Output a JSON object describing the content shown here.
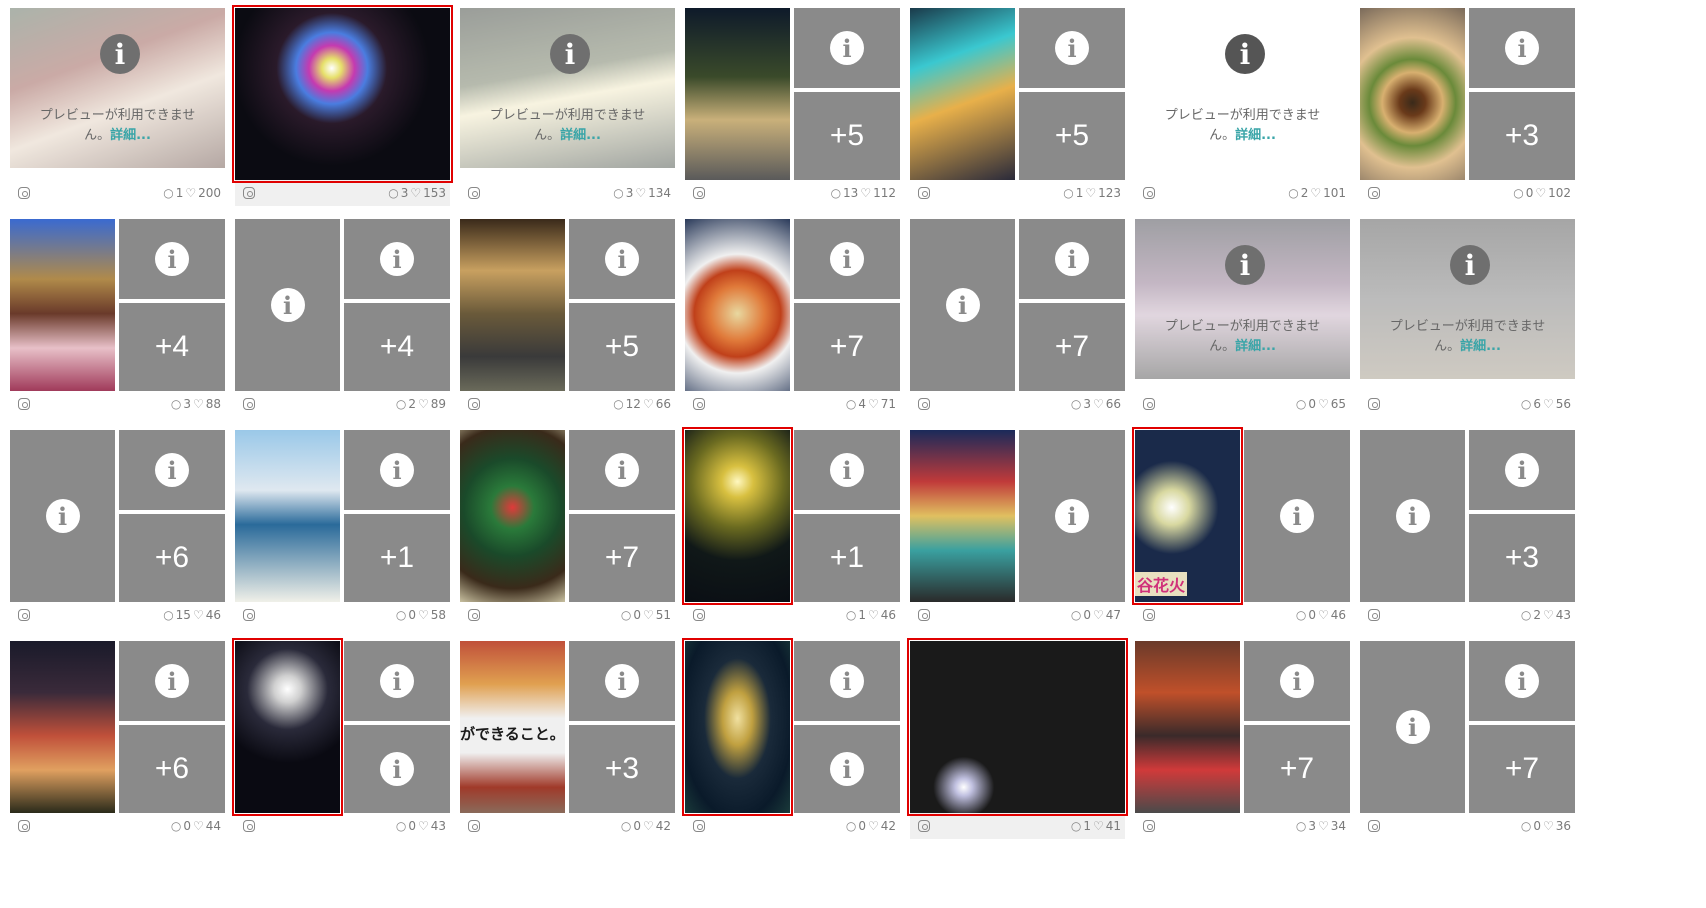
{
  "strings": {
    "preview_unavailable": "プレビューが利用できませ",
    "preview_unavailable_2": "ん。",
    "details_link": "詳細..."
  },
  "colors": {
    "tile_gray": "#8a8a8a",
    "highlight_border": "#e00000",
    "details_link": "#3aa5a8"
  },
  "posts": [
    {
      "id": "r1c1",
      "thumb": "preview",
      "photo": "santa",
      "comments": "1",
      "likes": "200"
    },
    {
      "id": "r1c2",
      "thumb": "single",
      "photo": "fireworks-night",
      "comments": "3",
      "likes": "153",
      "highlight": true,
      "shade": true
    },
    {
      "id": "r1c3",
      "thumb": "preview",
      "photo": "palm-lights",
      "comments": "3",
      "likes": "134"
    },
    {
      "id": "r1c4",
      "thumb": "grid",
      "photo": "girl-lights",
      "more": "+5",
      "comments": "13",
      "likes": "112"
    },
    {
      "id": "r1c5",
      "thumb": "grid",
      "photo": "food-collage",
      "more": "+5",
      "comments": "1",
      "likes": "123"
    },
    {
      "id": "r1c6",
      "thumb": "preview-plain",
      "comments": "2",
      "likes": "101"
    },
    {
      "id": "r1c7",
      "thumb": "grid",
      "photo": "ramen",
      "more": "+3",
      "comments": "0",
      "likes": "102"
    },
    {
      "id": "r2c1",
      "thumb": "grid",
      "photo": "crepe",
      "more": "+4",
      "comments": "3",
      "likes": "88"
    },
    {
      "id": "r2c2",
      "thumb": "grid-noimg",
      "more": "+4",
      "comments": "2",
      "likes": "89"
    },
    {
      "id": "r2c3",
      "thumb": "grid",
      "photo": "palm-man",
      "more": "+5",
      "comments": "12",
      "likes": "66"
    },
    {
      "id": "r2c4",
      "thumb": "grid",
      "photo": "seafood",
      "more": "+7",
      "comments": "4",
      "likes": "71"
    },
    {
      "id": "r2c5",
      "thumb": "grid-noimg",
      "more": "+7",
      "comments": "3",
      "likes": "66"
    },
    {
      "id": "r2c6",
      "thumb": "preview",
      "photo": "pink-fireworks",
      "comments": "0",
      "likes": "65"
    },
    {
      "id": "r2c7",
      "thumb": "preview",
      "photo": "dark-sky",
      "comments": "6",
      "likes": "56"
    },
    {
      "id": "r3c1",
      "thumb": "grid-noimg",
      "more": "+6",
      "comments": "15",
      "likes": "46"
    },
    {
      "id": "r3c2",
      "thumb": "grid",
      "photo": "figure-sea",
      "more": "+1",
      "comments": "0",
      "likes": "58"
    },
    {
      "id": "r3c3",
      "thumb": "grid",
      "photo": "xmas-tree",
      "more": "+7",
      "comments": "0",
      "likes": "51"
    },
    {
      "id": "r3c4",
      "thumb": "grid",
      "photo": "gold-fireworks",
      "more": "+1",
      "comments": "1",
      "likes": "46",
      "highlight": true
    },
    {
      "id": "r3c5",
      "thumb": "grid2",
      "photo": "building-night",
      "comments": "0",
      "likes": "47"
    },
    {
      "id": "r3c6",
      "thumb": "grid2",
      "photo": "fireworks-person",
      "caption": "谷花火",
      "comments": "0",
      "likes": "46",
      "highlight": true
    },
    {
      "id": "r3c7",
      "thumb": "grid-noimg",
      "more": "+3",
      "comments": "2",
      "likes": "43"
    },
    {
      "id": "r4c1",
      "thumb": "grid",
      "photo": "clock-tower",
      "more": "+6",
      "comments": "0",
      "likes": "44"
    },
    {
      "id": "r4c2",
      "thumb": "grid-info2",
      "photo": "fireworks-castle",
      "comments": "0",
      "likes": "43",
      "highlight": true
    },
    {
      "id": "r4c3",
      "thumb": "grid",
      "photo": "hotel-sign",
      "sign_text": "ができること。",
      "more": "+3",
      "comments": "0",
      "likes": "42"
    },
    {
      "id": "r4c4",
      "thumb": "grid-info2",
      "photo": "wide-fireworks",
      "comments": "0",
      "likes": "42",
      "highlight": true
    },
    {
      "id": "r4c5",
      "thumb": "single",
      "photo": "night-street",
      "comments": "1",
      "likes": "41",
      "highlight": true,
      "shade": true
    },
    {
      "id": "r4c6",
      "thumb": "grid",
      "photo": "red-building",
      "more": "+7",
      "comments": "3",
      "likes": "34"
    },
    {
      "id": "r4c7",
      "thumb": "grid-noimg",
      "more": "+7",
      "comments": "0",
      "likes": "36"
    }
  ]
}
